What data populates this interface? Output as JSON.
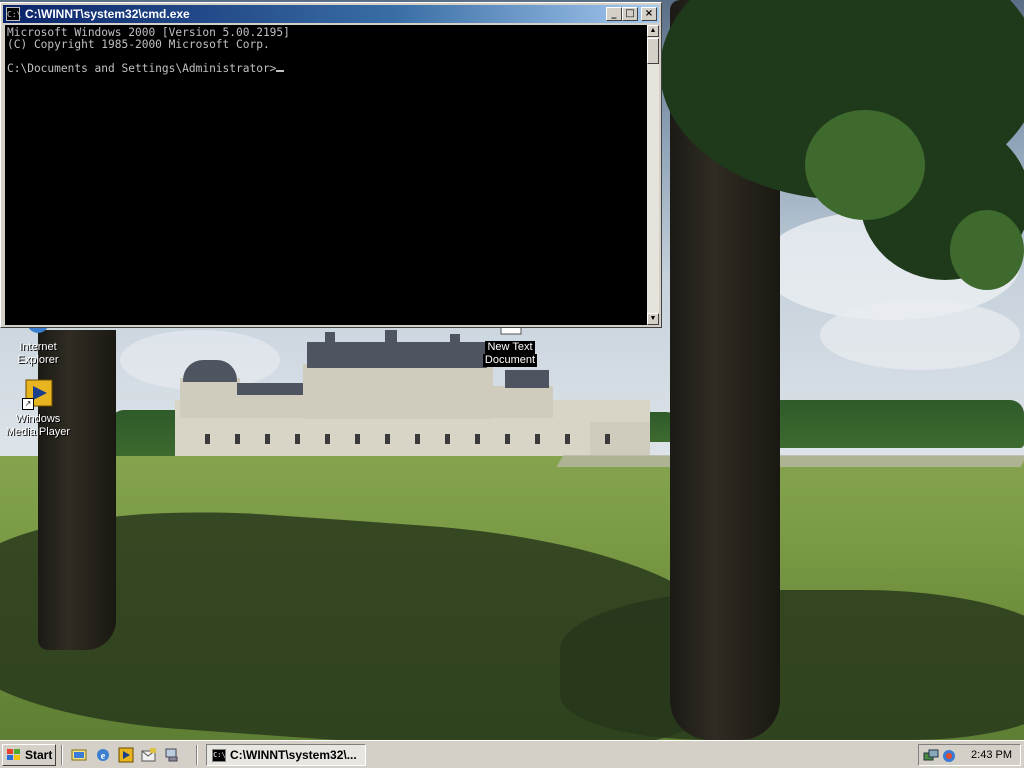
{
  "desktop": {
    "icons": [
      {
        "label_line1": "Internet",
        "label_line2": "Explorer",
        "selected": false
      },
      {
        "label_line1": "Windows",
        "label_line2": "Media Player",
        "selected": false
      },
      {
        "label_line1": "New Text",
        "label_line2": "Document",
        "selected": true
      }
    ]
  },
  "cmd_window": {
    "title": "C:\\WINNT\\system32\\cmd.exe",
    "minimize_glyph": "_",
    "maximize_glyph": "□",
    "close_glyph": "×",
    "icon_text": "C:\\",
    "console_text": "Microsoft Windows 2000 [Version 5.00.2195]\n(C) Copyright 1985-2000 Microsoft Corp.\n\nC:\\Documents and Settings\\Administrator>",
    "scroll_up_glyph": "▲",
    "scroll_down_glyph": "▼"
  },
  "taskbar": {
    "start_label": "Start",
    "quick_launch": [
      "show-desktop-icon",
      "internet-explorer-icon",
      "media-player-icon",
      "outlook-express-icon",
      "network-icon"
    ],
    "tasks": [
      {
        "label": "C:\\WINNT\\system32\\..."
      }
    ],
    "tray_icons": [
      "network-status-icon",
      "volume-icon"
    ],
    "clock": "2:43 PM"
  },
  "colors": {
    "titlebar_start": "#0a246a",
    "titlebar_end": "#a6caf0",
    "face": "#d4d0c8",
    "console_bg": "#000000",
    "console_fg": "#c0c0c0"
  }
}
